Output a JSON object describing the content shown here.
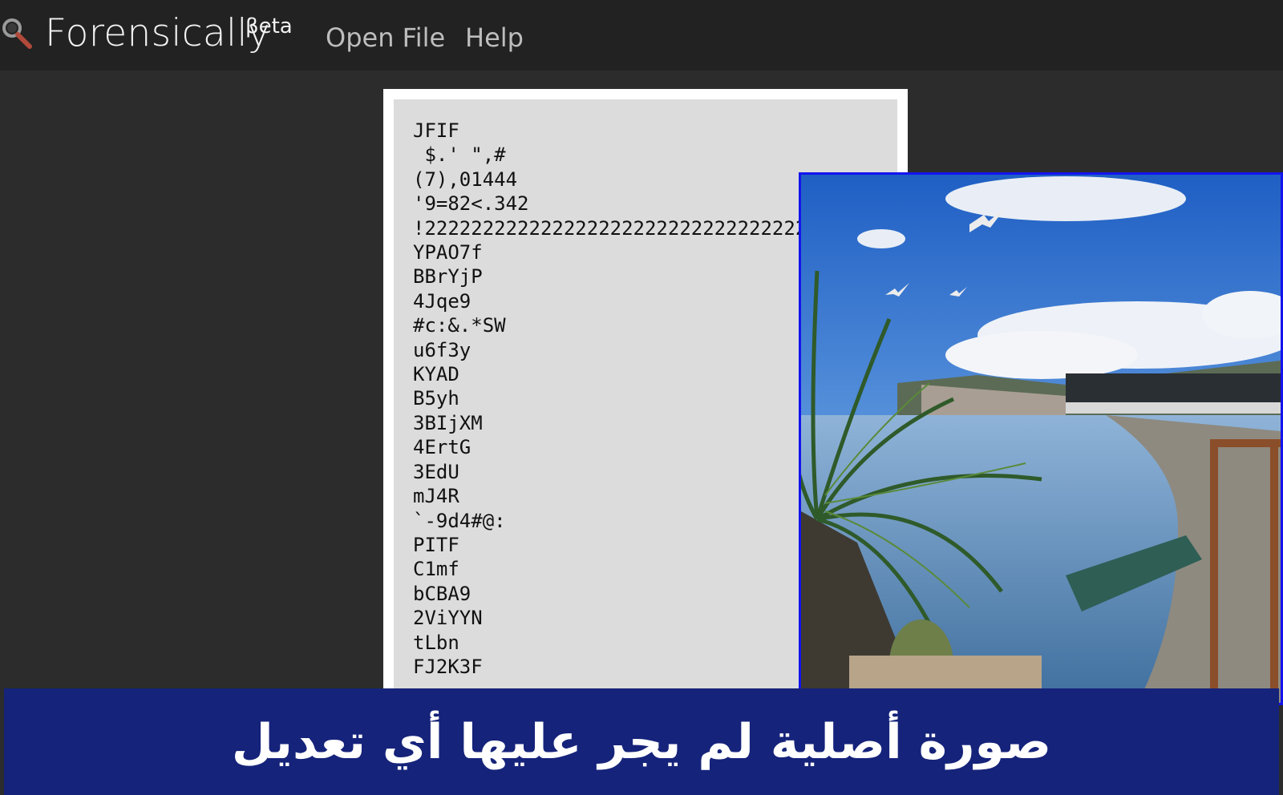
{
  "app": {
    "brand": "Forensically",
    "beta_label": "βeta",
    "logo_icon": "magnifier-icon"
  },
  "nav": {
    "open_file": "Open File",
    "help": "Help"
  },
  "strings_panel": {
    "lines": [
      "JFIF",
      " $.' \",#",
      "(7),01444",
      "'9=82<.342",
      "!22222222222222222222222222222222222222222222222222",
      "YPAO7f",
      "BBrYjP",
      "4Jqe9",
      "#c:&.*SW",
      "u6f3y",
      "KYAD",
      "B5yh",
      "3BIjXM",
      "4ErtG",
      "3EdU",
      "mJ4R",
      "`-9d4#@:",
      "PITF",
      "C1mf",
      "bCBA9",
      "2ViYYN",
      "tLbn",
      "FJ2K3F"
    ]
  },
  "caption": {
    "text": "صورة أصلية لم يجر عليها أي تعديل"
  },
  "colors": {
    "topbar": "#222222",
    "background": "#2c2c2c",
    "panel": "#dcdcdc",
    "photo_border": "#1414ee",
    "caption_band": "#15237a"
  }
}
